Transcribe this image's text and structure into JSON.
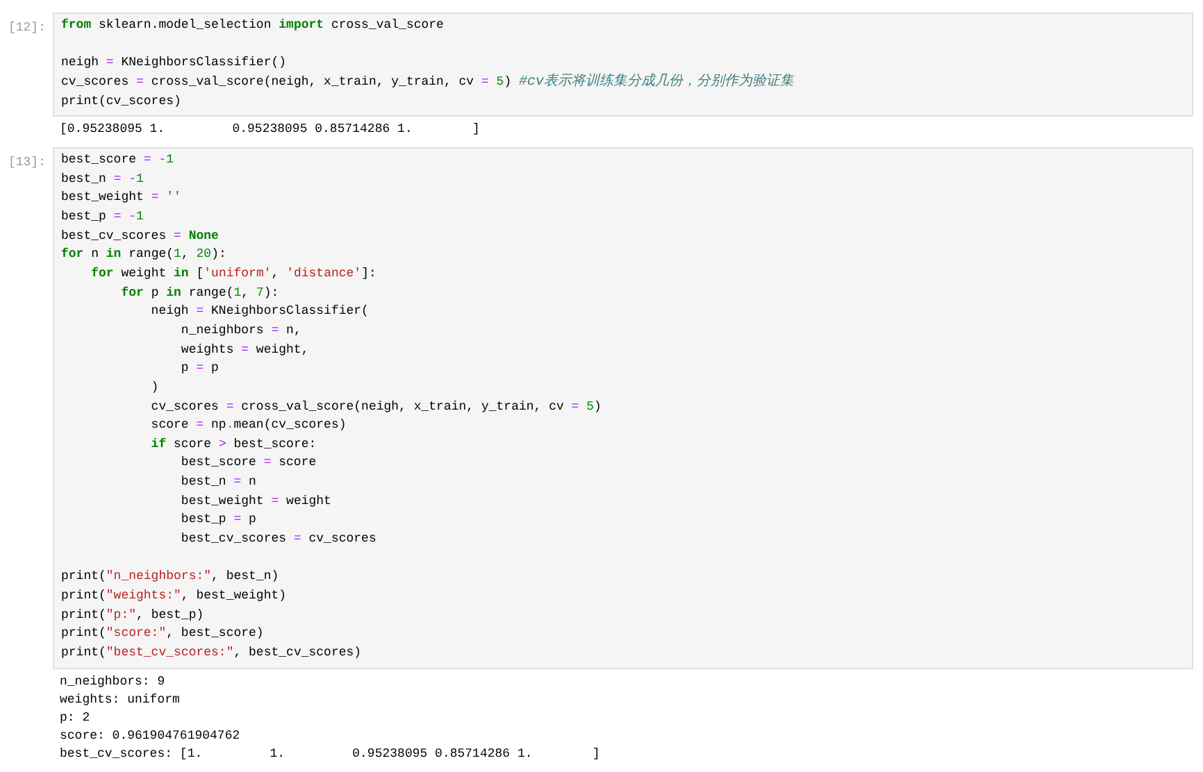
{
  "cells": [
    {
      "prompt": "[12]:",
      "source": [
        [
          [
            {
              "kind": "kw",
              "text": "from"
            },
            {
              "kind": "txt",
              "text": " sklearn.model_selection "
            },
            {
              "kind": "kw",
              "text": "import"
            },
            {
              "kind": "txt",
              "text": " cross_val_score"
            }
          ]
        ],
        [
          [
            {
              "kind": "txt",
              "text": "neigh "
            },
            {
              "kind": "op",
              "text": "="
            },
            {
              "kind": "txt",
              "text": " KNeighborsClassifier()"
            }
          ],
          [
            {
              "kind": "txt",
              "text": "cv_scores "
            },
            {
              "kind": "op",
              "text": "="
            },
            {
              "kind": "txt",
              "text": " cross_val_score(neigh, x_train, y_train, cv "
            },
            {
              "kind": "op",
              "text": "= "
            },
            {
              "kind": "num",
              "text": "5"
            },
            {
              "kind": "txt",
              "text": ") "
            },
            {
              "kind": "cmt",
              "text": "#cv表示将训练集分成几份，分别作为验证集"
            }
          ],
          [
            {
              "kind": "txt",
              "text": "print(cv_scores)"
            }
          ]
        ]
      ],
      "output": [
        "[0.95238095 1.         0.95238095 0.85714286 1.        ]"
      ]
    },
    {
      "prompt": "[13]:",
      "source": [
        [
          [
            {
              "kind": "txt",
              "text": "best_score "
            },
            {
              "kind": "op",
              "text": "= -"
            },
            {
              "kind": "num",
              "text": "1"
            }
          ],
          [
            {
              "kind": "txt",
              "text": "best_n "
            },
            {
              "kind": "op",
              "text": "= -"
            },
            {
              "kind": "num",
              "text": "1"
            }
          ],
          [
            {
              "kind": "txt",
              "text": "best_weight "
            },
            {
              "kind": "op",
              "text": "= "
            },
            {
              "kind": "str",
              "text": "''"
            }
          ],
          [
            {
              "kind": "txt",
              "text": "best_p "
            },
            {
              "kind": "op",
              "text": "= -"
            },
            {
              "kind": "num",
              "text": "1"
            }
          ],
          [
            {
              "kind": "txt",
              "text": "best_cv_scores "
            },
            {
              "kind": "op",
              "text": "= "
            },
            {
              "kind": "kw",
              "text": "None"
            }
          ],
          [
            {
              "kind": "kw",
              "text": "for"
            },
            {
              "kind": "txt",
              "text": " n "
            },
            {
              "kind": "kw",
              "text": "in"
            },
            {
              "kind": "txt",
              "text": " range("
            },
            {
              "kind": "num",
              "text": "1"
            },
            {
              "kind": "txt",
              "text": ", "
            },
            {
              "kind": "num",
              "text": "20"
            },
            {
              "kind": "txt",
              "text": "):"
            }
          ],
          [
            {
              "kind": "kw",
              "text": "    for"
            },
            {
              "kind": "txt",
              "text": " weight "
            },
            {
              "kind": "kw",
              "text": "in"
            },
            {
              "kind": "txt",
              "text": " ["
            },
            {
              "kind": "str",
              "text": "'uniform'"
            },
            {
              "kind": "txt",
              "text": ", "
            },
            {
              "kind": "str",
              "text": "'distance'"
            },
            {
              "kind": "txt",
              "text": "]:"
            }
          ],
          [
            {
              "kind": "kw",
              "text": "        for"
            },
            {
              "kind": "txt",
              "text": " p "
            },
            {
              "kind": "kw",
              "text": "in"
            },
            {
              "kind": "txt",
              "text": " range("
            },
            {
              "kind": "num",
              "text": "1"
            },
            {
              "kind": "txt",
              "text": ", "
            },
            {
              "kind": "num",
              "text": "7"
            },
            {
              "kind": "txt",
              "text": "):"
            }
          ],
          [
            {
              "kind": "txt",
              "text": "            neigh "
            },
            {
              "kind": "op",
              "text": "="
            },
            {
              "kind": "txt",
              "text": " KNeighborsClassifier("
            }
          ],
          [
            {
              "kind": "txt",
              "text": "                n_neighbors "
            },
            {
              "kind": "op",
              "text": "="
            },
            {
              "kind": "txt",
              "text": " n,"
            }
          ],
          [
            {
              "kind": "txt",
              "text": "                weights "
            },
            {
              "kind": "op",
              "text": "="
            },
            {
              "kind": "txt",
              "text": " weight,"
            }
          ],
          [
            {
              "kind": "txt",
              "text": "                p "
            },
            {
              "kind": "op",
              "text": "="
            },
            {
              "kind": "txt",
              "text": " p"
            }
          ],
          [
            {
              "kind": "txt",
              "text": "            )"
            }
          ],
          [
            {
              "kind": "txt",
              "text": "            cv_scores "
            },
            {
              "kind": "op",
              "text": "="
            },
            {
              "kind": "txt",
              "text": " cross_val_score(neigh, x_train, y_train, cv "
            },
            {
              "kind": "op",
              "text": "= "
            },
            {
              "kind": "num",
              "text": "5"
            },
            {
              "kind": "txt",
              "text": ")"
            }
          ],
          [
            {
              "kind": "txt",
              "text": "            score "
            },
            {
              "kind": "op",
              "text": "="
            },
            {
              "kind": "txt",
              "text": " np"
            },
            {
              "kind": "op",
              "text": "."
            },
            {
              "kind": "txt",
              "text": "mean(cv_scores)"
            }
          ],
          [
            {
              "kind": "kw",
              "text": "            if"
            },
            {
              "kind": "txt",
              "text": " score "
            },
            {
              "kind": "op",
              "text": ">"
            },
            {
              "kind": "txt",
              "text": " best_score:"
            }
          ],
          [
            {
              "kind": "txt",
              "text": "                best_score "
            },
            {
              "kind": "op",
              "text": "="
            },
            {
              "kind": "txt",
              "text": " score"
            }
          ],
          [
            {
              "kind": "txt",
              "text": "                best_n "
            },
            {
              "kind": "op",
              "text": "="
            },
            {
              "kind": "txt",
              "text": " n"
            }
          ],
          [
            {
              "kind": "txt",
              "text": "                best_weight "
            },
            {
              "kind": "op",
              "text": "="
            },
            {
              "kind": "txt",
              "text": " weight"
            }
          ],
          [
            {
              "kind": "txt",
              "text": "                best_p "
            },
            {
              "kind": "op",
              "text": "="
            },
            {
              "kind": "txt",
              "text": " p"
            }
          ],
          [
            {
              "kind": "txt",
              "text": "                best_cv_scores "
            },
            {
              "kind": "op",
              "text": "="
            },
            {
              "kind": "txt",
              "text": " cv_scores"
            }
          ]
        ],
        [
          [
            {
              "kind": "txt",
              "text": "print("
            },
            {
              "kind": "str",
              "text": "\"n_neighbors:\""
            },
            {
              "kind": "txt",
              "text": ", best_n)"
            }
          ],
          [
            {
              "kind": "txt",
              "text": "print("
            },
            {
              "kind": "str",
              "text": "\"weights:\""
            },
            {
              "kind": "txt",
              "text": ", best_weight)"
            }
          ],
          [
            {
              "kind": "txt",
              "text": "print("
            },
            {
              "kind": "str",
              "text": "\"p:\""
            },
            {
              "kind": "txt",
              "text": ", best_p)"
            }
          ],
          [
            {
              "kind": "txt",
              "text": "print("
            },
            {
              "kind": "str",
              "text": "\"score:\""
            },
            {
              "kind": "txt",
              "text": ", best_score)"
            }
          ],
          [
            {
              "kind": "txt",
              "text": "print("
            },
            {
              "kind": "str",
              "text": "\"best_cv_scores:\""
            },
            {
              "kind": "txt",
              "text": ", best_cv_scores)"
            }
          ]
        ]
      ],
      "output": [
        "n_neighbors: 9",
        "weights: uniform",
        "p: 2",
        "score: 0.961904761904762",
        "best_cv_scores: [1.         1.         0.95238095 0.85714286 1.        ]"
      ]
    }
  ]
}
